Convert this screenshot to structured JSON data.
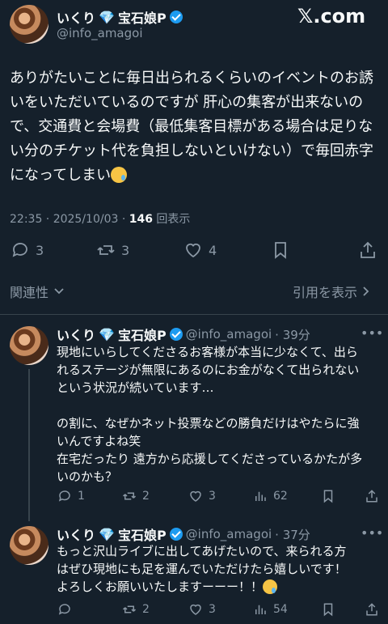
{
  "main_tweet": {
    "display_name": "いくり",
    "display_suffix": "宝石娘P",
    "handle": "@info_amagoi",
    "logo_text": "𝕏.com",
    "lines": [
      "ありがたいことに毎日出られるくらいのイベントのお誘",
      "いをいただいているのですが 肝心の集客が出来ないの",
      "で、交通費と会場費（最低集客目標がある場合は足りな",
      "い分のチケット代を負担しないといけない）で毎回赤字",
      "になってしまい"
    ],
    "timestamp": "22:35 · 2025/10/03 · ",
    "views_count": "146",
    "views_label": " 回表示",
    "replies": "3",
    "reposts": "3",
    "likes": "4"
  },
  "related_label": "関連性",
  "quotes_label": "引用を表示",
  "replies": [
    {
      "display_name": "いくり",
      "display_suffix": "宝石娘P",
      "handle": "@info_amagoi",
      "time": "· 39分",
      "lines": [
        "現地にいらしてくださるお客様が本当に少なくて、出ら",
        "れるステージが無限にあるのにお金がなくて出られない",
        "という状況が続いています…",
        "",
        "の割に、なぜかネット投票などの勝負だけはやたらに強",
        "いんですよね笑",
        "在宅だったり 遠方から応援してくださっているかたが多",
        "いのかも？"
      ],
      "replies": "1",
      "reposts": "2",
      "likes": "3",
      "views": "62"
    },
    {
      "display_name": "いくり",
      "display_suffix": "宝石娘P",
      "handle": "@info_amagoi",
      "time": "· 37分",
      "lines": [
        "もっと沢山ライブに出してあげたいので、来られる方",
        "はぜひ現地にも足を運んでいただけたら嬉しいです！",
        "よろしくお願いいたしますーーー！！"
      ],
      "replies": "",
      "reposts": "2",
      "likes": "3",
      "views": "54"
    }
  ]
}
